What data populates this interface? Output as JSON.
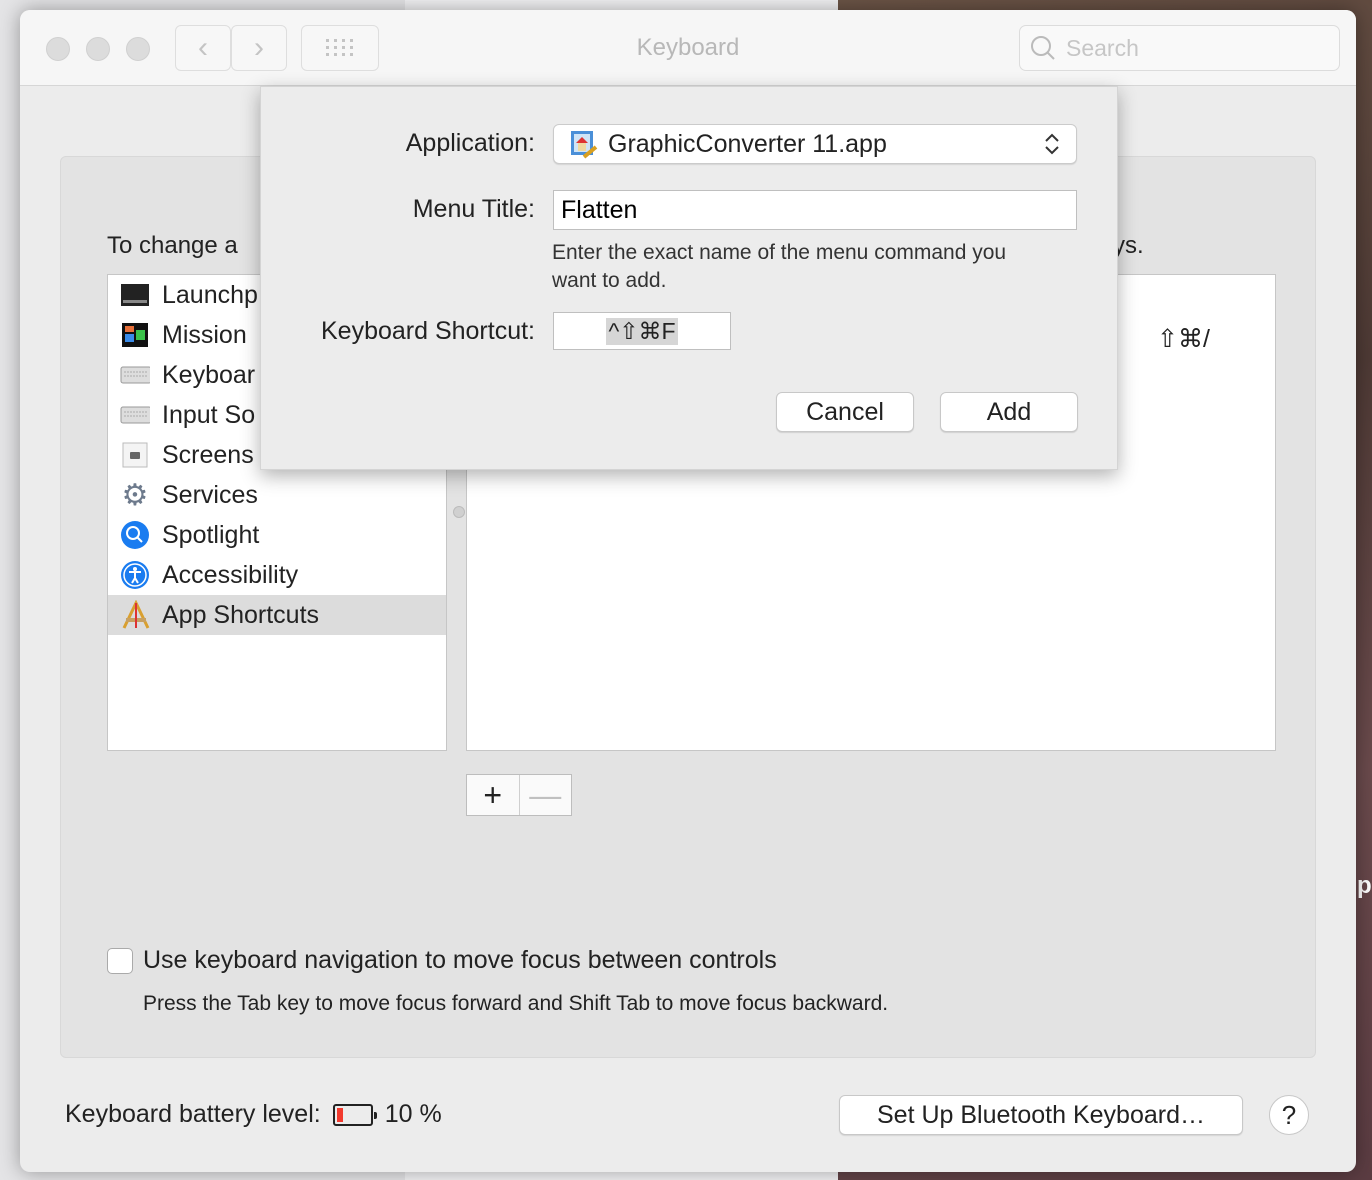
{
  "window": {
    "title": "Keyboard",
    "search_placeholder": "Search",
    "back": "‹",
    "forward": "›"
  },
  "panel": {
    "instruction_left": "To change a",
    "instruction_right": "ys.",
    "categories": [
      {
        "label": "Launchp",
        "icon": "launchpad-icon"
      },
      {
        "label": "Mission",
        "icon": "mission-control-icon"
      },
      {
        "label": "Keyboar",
        "icon": "keyboard-icon"
      },
      {
        "label": "Input So",
        "icon": "input-sources-icon"
      },
      {
        "label": "Screens",
        "icon": "screenshot-icon"
      },
      {
        "label": "Services",
        "icon": "gear-icon"
      },
      {
        "label": "Spotlight",
        "icon": "spotlight-icon"
      },
      {
        "label": "Accessibility",
        "icon": "accessibility-icon"
      },
      {
        "label": "App Shortcuts",
        "icon": "app-shortcuts-icon",
        "selected": true
      }
    ],
    "detail_shortcut": "⇧⌘/",
    "add": "+",
    "remove": "—"
  },
  "keyboard_nav": {
    "checked": false,
    "label": "Use keyboard navigation to move focus between controls",
    "help": "Press the Tab key to move focus forward and Shift Tab to move focus backward."
  },
  "footer": {
    "battery_label": "Keyboard battery level:",
    "battery_percent": 10,
    "battery_text": "10 %",
    "battery_color": "#f23a2e",
    "bluetooth_button": "Set Up Bluetooth Keyboard…",
    "help": "?"
  },
  "sheet": {
    "application_label": "Application:",
    "application_value": "GraphicConverter 11.app",
    "menu_title_label": "Menu Title:",
    "menu_title_value": "Flatten",
    "hint": "Enter the exact name of the menu command you want to add.",
    "shortcut_label": "Keyboard Shortcut:",
    "shortcut_value": "^⇧⌘F",
    "cancel": "Cancel",
    "add": "Add"
  },
  "background": {
    "photo_letter": "p"
  }
}
